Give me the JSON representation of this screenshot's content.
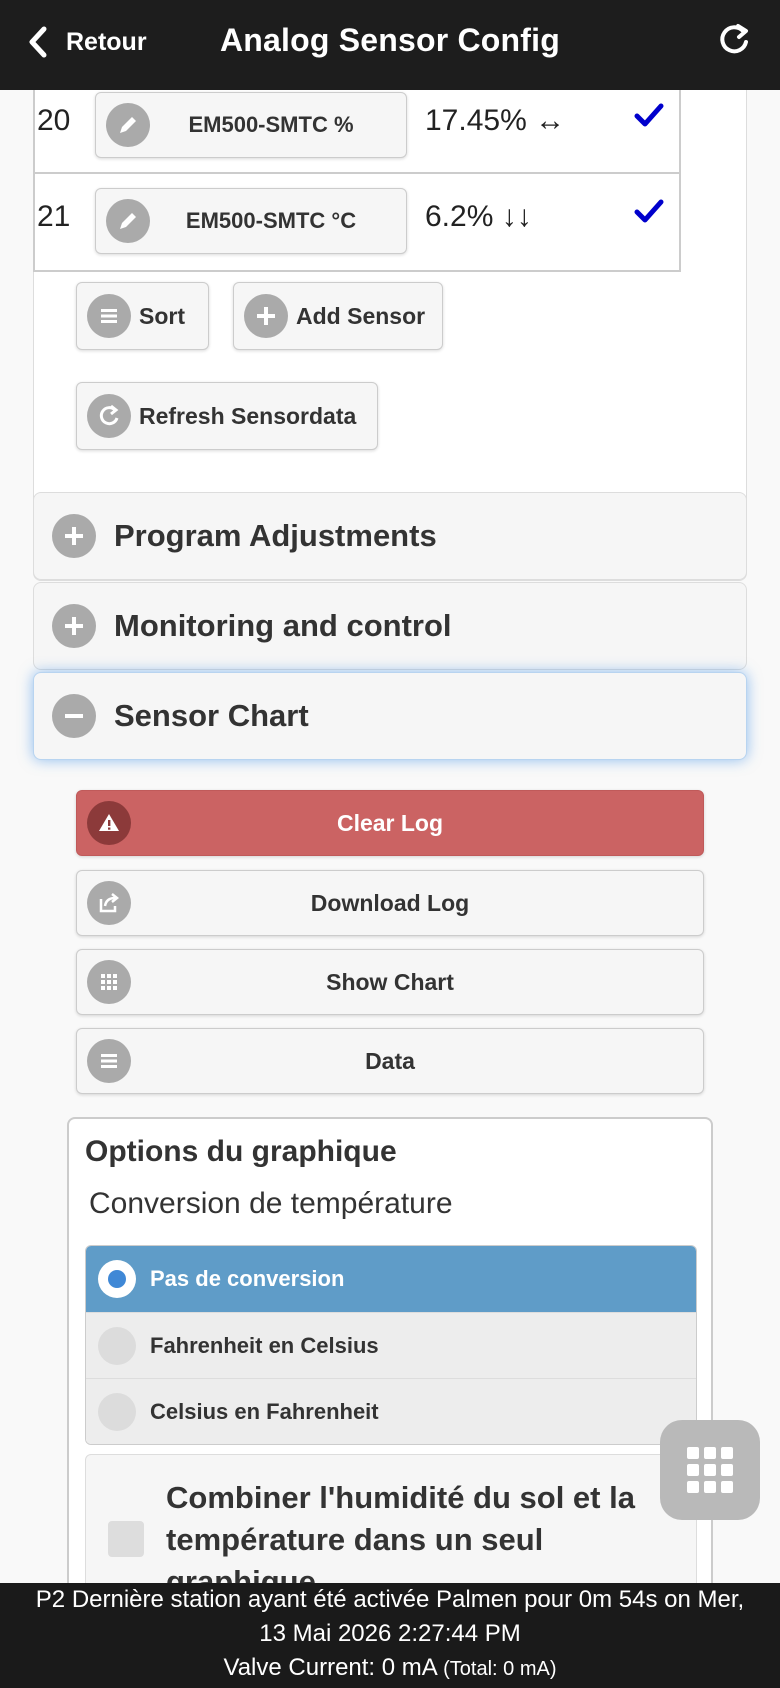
{
  "header": {
    "back_label": "Retour",
    "title": "Analog Sensor Config",
    "refresh_icon": "refresh-icon"
  },
  "sensors": [
    {
      "number": "20",
      "name": "EM500-SMTC %",
      "value": "17.45% ↔",
      "enabled": true
    },
    {
      "number": "21",
      "name": "EM500-SMTC °C",
      "value": "6.2% ↓↓",
      "enabled": true
    }
  ],
  "sensor_actions": {
    "sort_label": "Sort",
    "add_label": "Add Sensor",
    "refresh_label": "Refresh Sensordata"
  },
  "sections": {
    "program_adjustments": "Program Adjustments",
    "monitoring": "Monitoring and control",
    "sensor_chart": "Sensor Chart"
  },
  "chart_actions": {
    "clear_log": "Clear Log",
    "download_log": "Download Log",
    "show_chart": "Show Chart",
    "data": "Data"
  },
  "chart_options": {
    "title": "Options du graphique",
    "conversion_title": "Conversion de température",
    "conversion_options": [
      "Pas de conversion",
      "Fahrenheit en Celsius",
      "Celsius en Fahrenheit"
    ],
    "selected_conversion": "Pas de conversion",
    "combine_label": "Combiner l'humidité du sol et la température dans un seul graphique"
  },
  "footer": {
    "line1": "P2 Dernière station ayant été activée Palmen pour 0m 54s on Mer,",
    "line2": "13 Mai 2026 2:27:44 PM",
    "line3": "Valve Current: 0 mA",
    "line3_small": "(Total: 0 mA)"
  },
  "colors": {
    "header_bg": "#1d1d1d",
    "danger": "#cb6363",
    "selected_radio": "#5f9cc8",
    "check_blue": "#0000cc"
  }
}
